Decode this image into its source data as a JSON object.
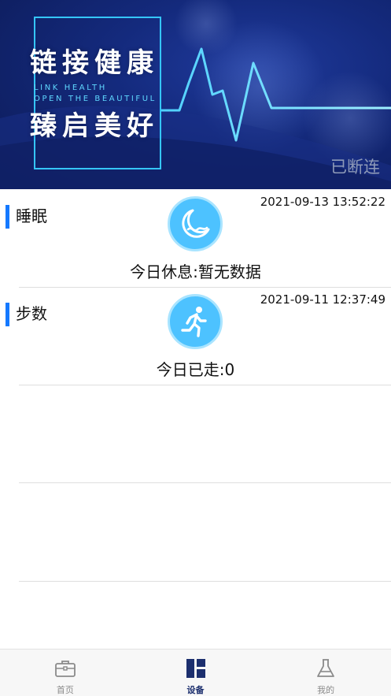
{
  "banner": {
    "slogan_line1": "链接健康",
    "slogan_en_line1": "LINK HEALTH",
    "slogan_en_line2": "OPEN THE BEAUTIFUL",
    "slogan_line2": "臻启美好",
    "connection_status": "已断连"
  },
  "cards": [
    {
      "title": "睡眠",
      "timestamp": "2021-09-13 13:52:22",
      "value": "今日休息:暂无数据",
      "icon": "moon-sleep-icon"
    },
    {
      "title": "步数",
      "timestamp": "2021-09-11 12:37:49",
      "value": "今日已走:0",
      "icon": "running-person-icon"
    }
  ],
  "tabbar": {
    "items": [
      {
        "label": "首页",
        "icon": "briefcase-icon",
        "active": false
      },
      {
        "label": "设备",
        "icon": "grid-dashboard-icon",
        "active": true
      },
      {
        "label": "我的",
        "icon": "flask-icon",
        "active": false
      }
    ]
  },
  "colors": {
    "accent": "#1479ff",
    "icon_bg": "#4dc2ff",
    "active_tab": "#1c2f6e",
    "inactive_tab": "#8a8a8a"
  }
}
